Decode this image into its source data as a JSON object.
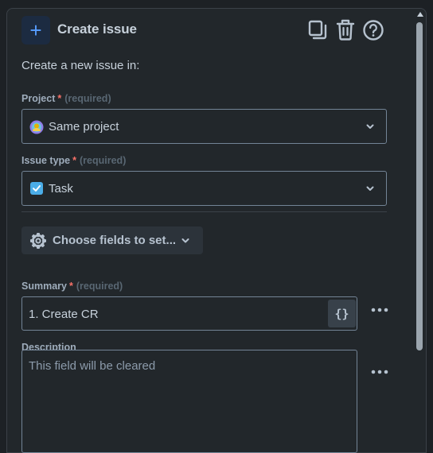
{
  "header": {
    "title": "Create issue",
    "plus_symbol": "+",
    "icons": [
      "plus-icon",
      "copy-icon",
      "trash-icon",
      "help-icon"
    ]
  },
  "intro_text": "Create a new issue in:",
  "project": {
    "label": "Project",
    "required_mark": "*",
    "required_text": "(required)",
    "value": "Same project",
    "icon": "project-avatar-icon"
  },
  "issue_type": {
    "label": "Issue type",
    "required_mark": "*",
    "required_text": "(required)",
    "value": "Task",
    "icon": "task-checkbox-icon"
  },
  "choose_fields": {
    "label": "Choose fields to set...",
    "icon": "gear-icon"
  },
  "summary": {
    "label": "Summary",
    "required_mark": "*",
    "required_text": "(required)",
    "value": "1. Create CR",
    "smart_value_label": "{}"
  },
  "description": {
    "label": "Description",
    "placeholder": "This field will be cleared"
  },
  "colors": {
    "accent": "#579dff",
    "required": "#f87168",
    "background": "#22272b"
  }
}
